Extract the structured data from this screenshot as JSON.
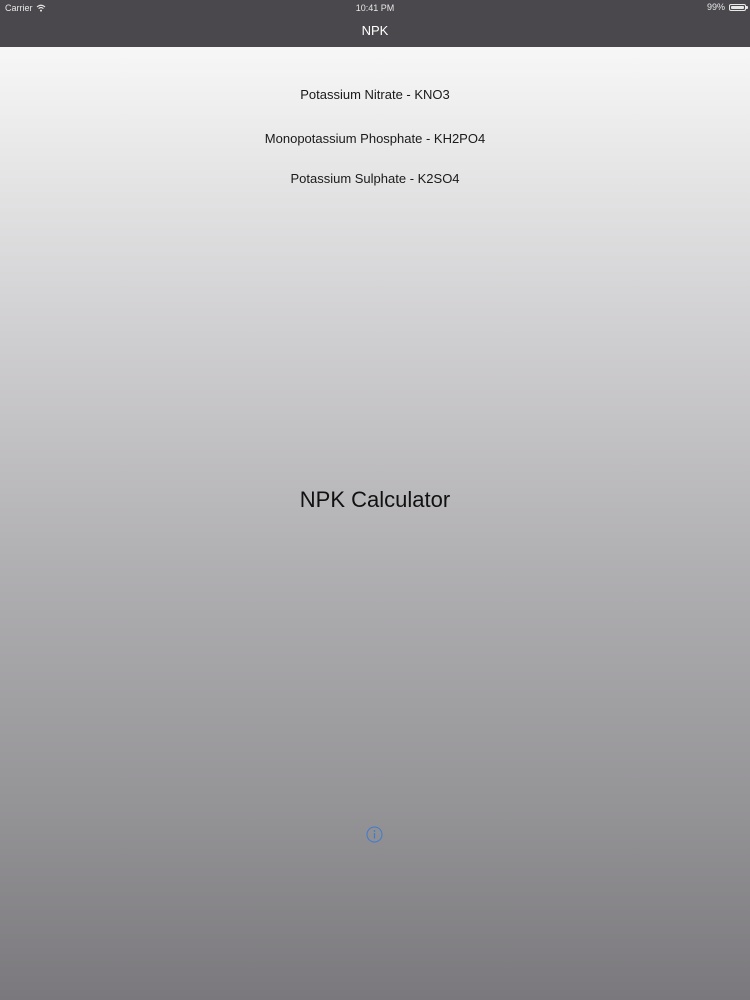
{
  "status_bar": {
    "carrier": "Carrier",
    "time": "10:41 PM",
    "battery": "99%",
    "battery_level": 0.99,
    "wifi_icon": "wifi-icon",
    "battery_icon": "battery-icon"
  },
  "nav": {
    "title": "NPK"
  },
  "menu": {
    "items": [
      {
        "label": "Potassium Nitrate - KNO3"
      },
      {
        "label": "Monopotassium Phosphate - KH2PO4"
      },
      {
        "label": "Potassium Sulphate - K2SO4"
      }
    ]
  },
  "main": {
    "title": "NPK Calculator",
    "info_icon": "info-icon"
  },
  "colors": {
    "nav_bar": "#4a484c",
    "accent": "#3a7bd5",
    "gradient_top": "#f7f7f7",
    "gradient_bottom": "#7a787c"
  }
}
